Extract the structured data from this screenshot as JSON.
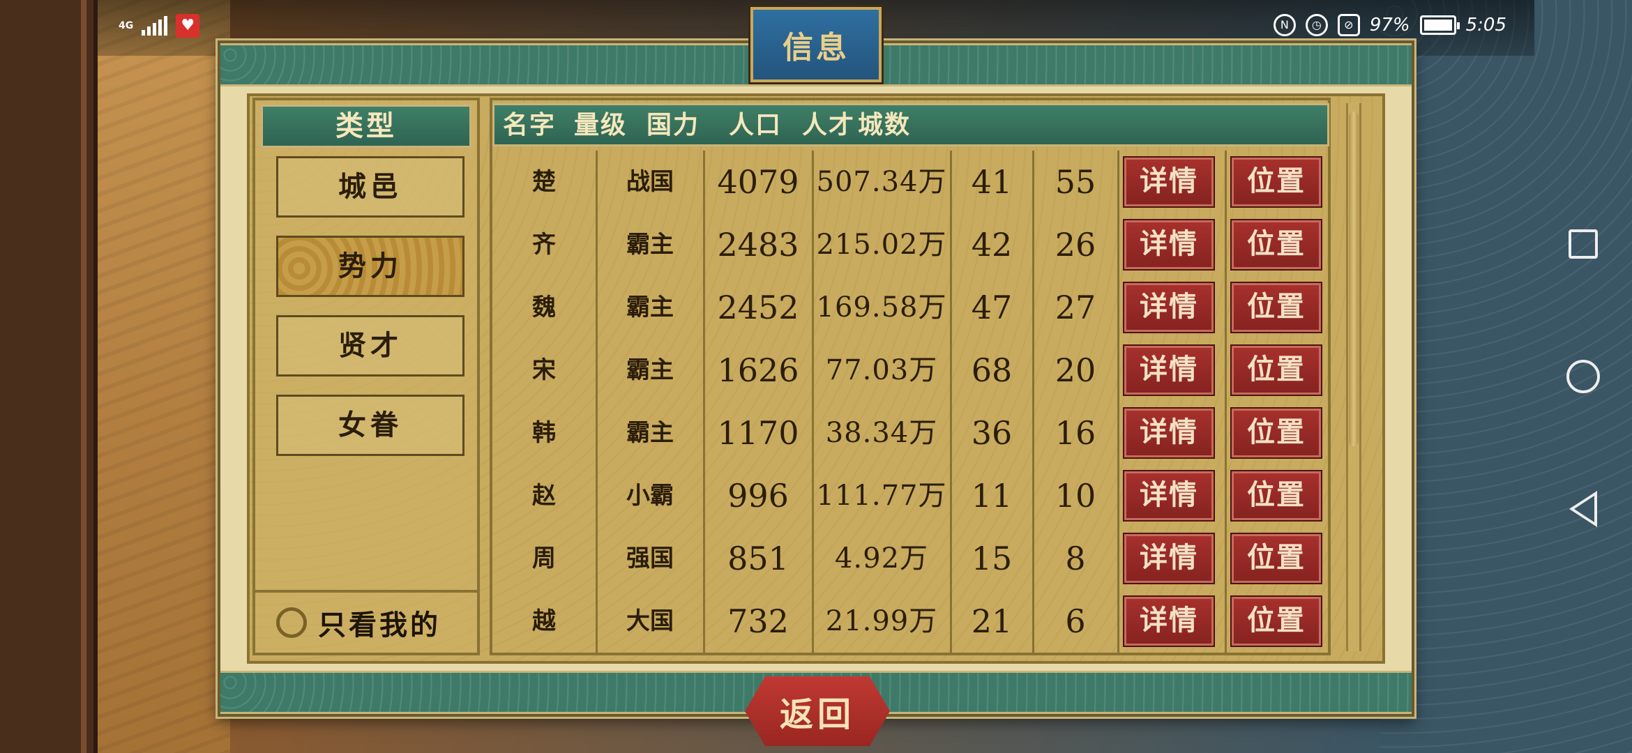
{
  "status_bar": {
    "network": "4G",
    "battery": "97%",
    "time": "5:05"
  },
  "dialog": {
    "title": "信息",
    "return_label": "返回"
  },
  "left_panel": {
    "header": "类型",
    "categories": [
      {
        "label": "城邑",
        "active": false
      },
      {
        "label": "势力",
        "active": true
      },
      {
        "label": "贤才",
        "active": false
      },
      {
        "label": "女眷",
        "active": false
      }
    ],
    "only_mine_label": "只看我的"
  },
  "table": {
    "columns": [
      "名字",
      "量级",
      "国力",
      "人口",
      "人才",
      "城数"
    ],
    "detail_label": "详情",
    "location_label": "位置",
    "rows": [
      {
        "name": "楚",
        "level": "战国",
        "power": "4079",
        "population": "507.34万",
        "talent": "41",
        "cities": "55"
      },
      {
        "name": "齐",
        "level": "霸主",
        "power": "2483",
        "population": "215.02万",
        "talent": "42",
        "cities": "26"
      },
      {
        "name": "魏",
        "level": "霸主",
        "power": "2452",
        "population": "169.58万",
        "talent": "47",
        "cities": "27"
      },
      {
        "name": "宋",
        "level": "霸主",
        "power": "1626",
        "population": "77.03万",
        "talent": "68",
        "cities": "20"
      },
      {
        "name": "韩",
        "level": "霸主",
        "power": "1170",
        "population": "38.34万",
        "talent": "36",
        "cities": "16"
      },
      {
        "name": "赵",
        "level": "小霸",
        "power": "996",
        "population": "111.77万",
        "talent": "11",
        "cities": "10"
      },
      {
        "name": "周",
        "level": "强国",
        "power": "851",
        "population": "4.92万",
        "talent": "15",
        "cities": "8"
      },
      {
        "name": "越",
        "level": "大国",
        "power": "732",
        "population": "21.99万",
        "talent": "21",
        "cities": "6"
      }
    ]
  },
  "icons": {
    "signal": "signal-bars-icon",
    "notification_app": "heart-app-icon",
    "alarm": "alarm-icon",
    "mute": "bell-off-icon",
    "battery": "battery-icon",
    "nav_recent": "square-icon",
    "nav_home": "circle-icon",
    "nav_back": "triangle-back-icon"
  },
  "colors": {
    "header_green": "#3f7f67",
    "button_red": "#a6302c",
    "parchment": "#c8ab5e",
    "title_blue": "#2f6fa0"
  }
}
